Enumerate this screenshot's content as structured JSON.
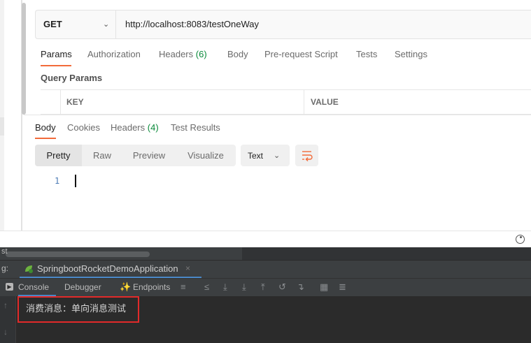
{
  "request": {
    "method": "GET",
    "url": "http://localhost:8083/testOneWay"
  },
  "request_tabs": [
    {
      "label": "Params",
      "count": ""
    },
    {
      "label": "Authorization",
      "count": ""
    },
    {
      "label": "Headers",
      "count": "(6)"
    },
    {
      "label": "Body",
      "count": ""
    },
    {
      "label": "Pre-request Script",
      "count": ""
    },
    {
      "label": "Tests",
      "count": ""
    },
    {
      "label": "Settings",
      "count": ""
    }
  ],
  "query_params": {
    "title": "Query Params",
    "columns": [
      "KEY",
      "VALUE"
    ]
  },
  "response_tabs": [
    {
      "label": "Body",
      "count": ""
    },
    {
      "label": "Cookies",
      "count": ""
    },
    {
      "label": "Headers",
      "count": "(4)"
    },
    {
      "label": "Test Results",
      "count": ""
    }
  ],
  "view_modes": [
    "Pretty",
    "Raw",
    "Preview",
    "Visualize"
  ],
  "format": "Text",
  "editor": {
    "line_number": "1"
  },
  "ide": {
    "top_text": "st",
    "run_prefix": "g:",
    "run_config": "SpringbootRocketDemoApplication",
    "close_glyph": "×",
    "toolbar": {
      "console": "Console",
      "debugger": "Debugger",
      "endpoints": "Endpoints"
    },
    "output": "消费消息：单向消息测试"
  },
  "colors": {
    "accent": "#f26b3a",
    "count_green": "#0a8a3a",
    "highlight": "#e22a2a"
  }
}
